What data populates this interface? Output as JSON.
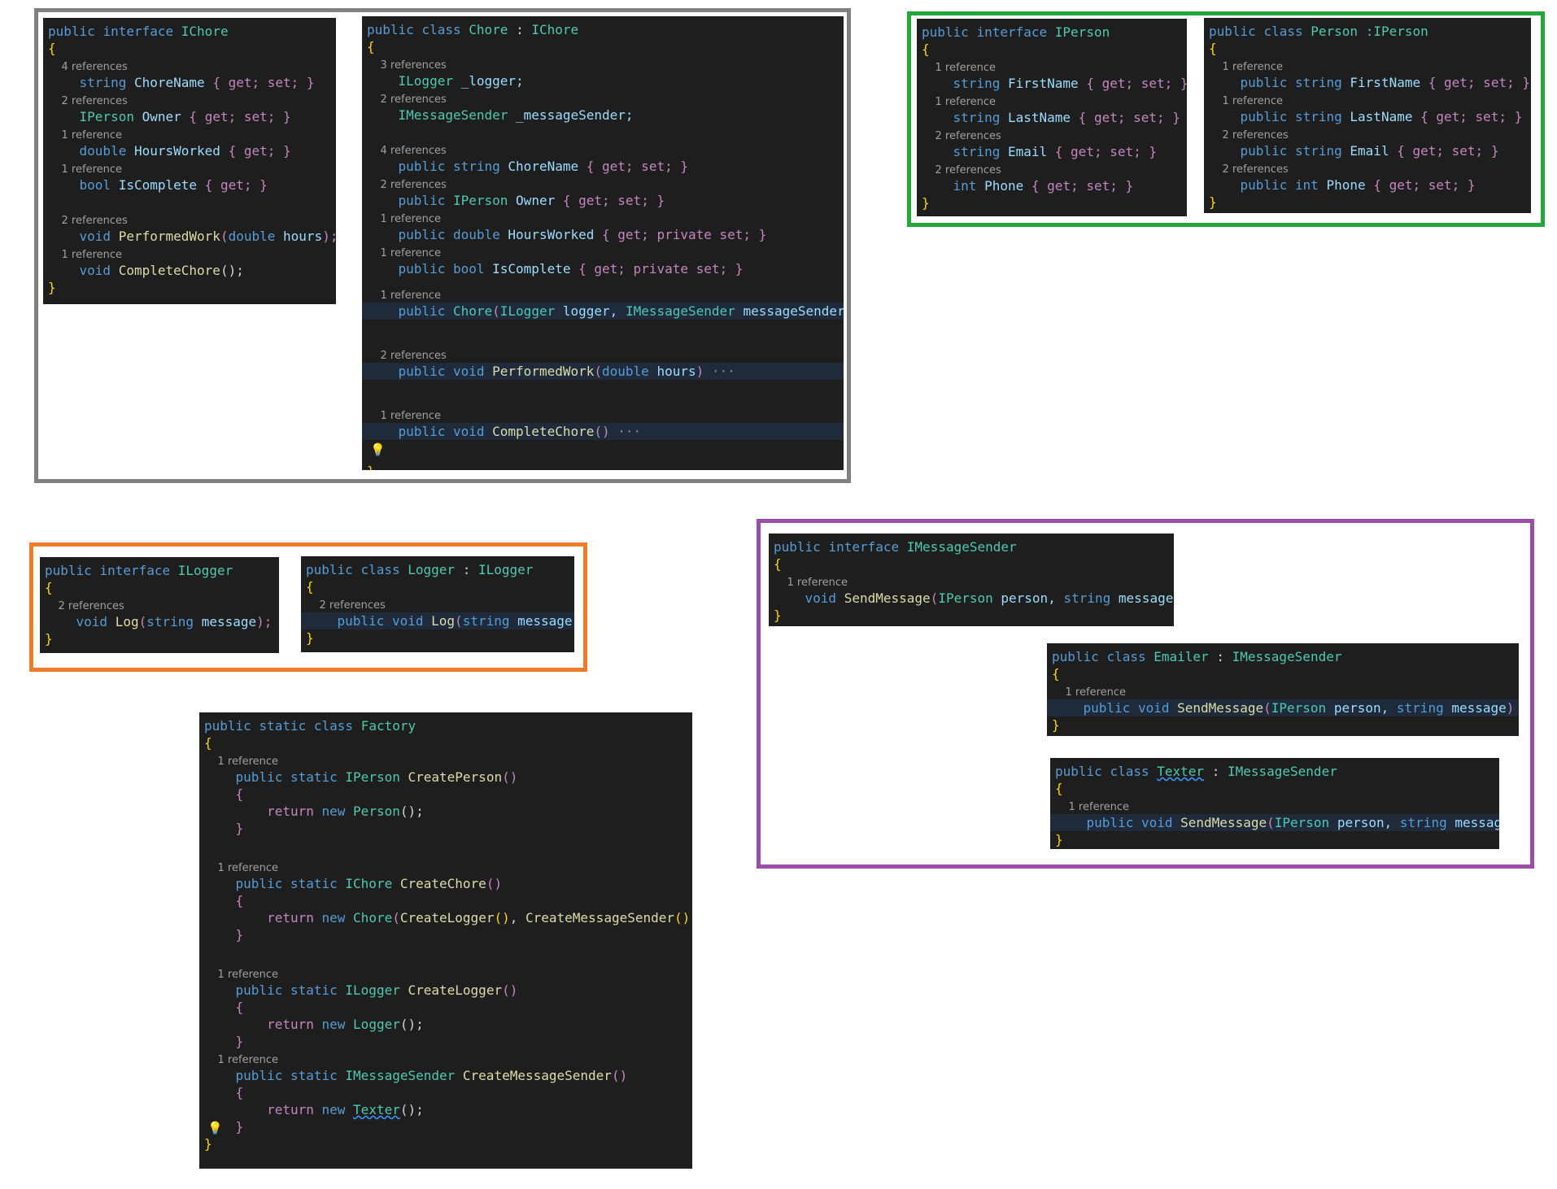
{
  "chore_interface": {
    "decl": [
      "public",
      "interface",
      "IChore"
    ],
    "open": "{",
    "close": "}",
    "members": [
      {
        "refs": "4 references",
        "type": "string",
        "name": "ChoreName",
        "acc": "{ get; set; }"
      },
      {
        "refs": "2 references",
        "type": "IPerson",
        "name": "Owner",
        "acc": "{ get; set; }"
      },
      {
        "refs": "1 reference",
        "type": "double",
        "name": "HoursWorked",
        "acc": "{ get; }"
      },
      {
        "refs": "1 reference",
        "type": "bool",
        "name": "IsComplete",
        "acc": "{ get; }"
      }
    ],
    "methods": [
      {
        "refs": "2 references",
        "ret": "void",
        "name": "PerformedWork",
        "ptype": "double",
        "pname": "hours",
        "tail": ");"
      },
      {
        "refs": "1 reference",
        "ret": "void",
        "name": "CompleteChore",
        "tail": "();"
      }
    ]
  },
  "chore_class": {
    "decl": [
      "public",
      "class",
      "Chore",
      ":",
      "IChore"
    ],
    "open": "{",
    "close": "}",
    "fields": [
      {
        "refs": "3 references",
        "type": "ILogger",
        "name": "_logger;"
      },
      {
        "refs": "2 references",
        "type": "IMessageSender",
        "name": "_messageSender;"
      }
    ],
    "props": [
      {
        "refs": "4 references",
        "mod": "public",
        "type": "string",
        "name": "ChoreName",
        "acc": "{ get; set; }"
      },
      {
        "refs": "2 references",
        "mod": "public",
        "type": "IPerson",
        "name": "Owner",
        "acc": "{ get; set; }"
      },
      {
        "refs": "1 reference",
        "mod": "public",
        "type": "double",
        "name": "HoursWorked",
        "acc": "{ get; private set; }"
      },
      {
        "refs": "1 reference",
        "mod": "public",
        "type": "bool",
        "name": "IsComplete",
        "acc": "{ get; private set; }"
      }
    ],
    "ctor": {
      "refs": "1 reference",
      "mod": "public",
      "name": "Chore",
      "p1type": "ILogger",
      "p1": "logger,",
      "p2type": "IMessageSender",
      "p2": "messageSender"
    },
    "methods": [
      {
        "refs": "2 references",
        "mod": "public",
        "ret": "void",
        "name": "PerformedWork",
        "ptype": "double",
        "pname": "hours",
        "ellipsis": "···"
      },
      {
        "refs": "1 reference",
        "mod": "public",
        "ret": "void",
        "name": "CompleteChore",
        "ellipsis": "···"
      }
    ]
  },
  "person_interface": {
    "decl": [
      "public",
      "interface",
      "IPerson"
    ],
    "open": "{",
    "close": "}",
    "members": [
      {
        "refs": "1 reference",
        "type": "string",
        "name": "FirstName",
        "acc": "{ get; set; }"
      },
      {
        "refs": "1 reference",
        "type": "string",
        "name": "LastName",
        "acc": "{ get; set; }"
      },
      {
        "refs": "2 references",
        "type": "string",
        "name": "Email",
        "acc": "{ get; set; }"
      },
      {
        "refs": "2 references",
        "type": "int",
        "name": "Phone",
        "acc": "{ get; set; }"
      }
    ]
  },
  "person_class": {
    "decl": [
      "public",
      "class",
      "Person",
      ":IPerson"
    ],
    "open": "{",
    "close": "}",
    "members": [
      {
        "refs": "1 reference",
        "mod": "public",
        "type": "string",
        "name": "FirstName",
        "acc": "{ get; set; }"
      },
      {
        "refs": "1 reference",
        "mod": "public",
        "type": "string",
        "name": "LastName",
        "acc": "{ get; set; }"
      },
      {
        "refs": "2 references",
        "mod": "public",
        "type": "string",
        "name": "Email",
        "acc": "{ get; set; }"
      },
      {
        "refs": "2 references",
        "mod": "public",
        "type": "int",
        "name": "Phone",
        "acc": "{ get; set; }"
      }
    ]
  },
  "logger_interface": {
    "decl": [
      "public",
      "interface",
      "ILogger"
    ],
    "open": "{",
    "close": "}",
    "method": {
      "refs": "2 references",
      "ret": "void",
      "name": "Log",
      "ptype": "string",
      "pname": "message",
      "tail": ");"
    }
  },
  "logger_class": {
    "decl": [
      "public",
      "class",
      "Logger",
      ":",
      "ILogger"
    ],
    "open": "{",
    "close": "}",
    "method": {
      "refs": "2 references",
      "mod": "public",
      "ret": "void",
      "name": "Log",
      "ptype": "string",
      "pname": "message",
      "tail": ")"
    }
  },
  "sender_interface": {
    "decl": [
      "public",
      "interface",
      "IMessageSender"
    ],
    "open": "{",
    "close": "}",
    "method": {
      "refs": "1 reference",
      "ret": "void",
      "name": "SendMessage",
      "p1type": "IPerson",
      "p1": "person,",
      "p2type": "string",
      "p2": "message",
      "tail": ");"
    }
  },
  "emailer_class": {
    "decl": [
      "public",
      "class",
      "Emailer",
      ":",
      "IMessageSender"
    ],
    "open": "{",
    "close": "}",
    "method": {
      "refs": "1 reference",
      "mod": "public",
      "ret": "void",
      "name": "SendMessage",
      "p1type": "IPerson",
      "p1": "person,",
      "p2type": "string",
      "p2": "message",
      "tail": ")",
      "ellipsis": "···"
    }
  },
  "texter_class": {
    "decl": [
      "public",
      "class",
      "Texter",
      ":",
      "IMessageSender"
    ],
    "open": "{",
    "close": "}",
    "method": {
      "refs": "1 reference",
      "mod": "public",
      "ret": "void",
      "name": "SendMessage",
      "p1type": "IPerson",
      "p1": "person,",
      "p2type": "string",
      "p2": "message",
      "tail": ")"
    }
  },
  "factory_class": {
    "decl": [
      "public",
      "static",
      "class",
      "Factory"
    ],
    "open": "{",
    "close": "}",
    "methods": [
      {
        "refs": "1 reference",
        "mods": "public static",
        "ret": "IPerson",
        "name": "CreatePerson",
        "open": "{",
        "close": "}",
        "ret_kw": "return",
        "new_kw": "new",
        "ctor": "Person",
        "args": "();"
      },
      {
        "refs": "1 reference",
        "mods": "public static",
        "ret": "IChore",
        "name": "CreateChore",
        "open": "{",
        "close": "}",
        "ret_kw": "return",
        "new_kw": "new",
        "ctor": "Chore",
        "arg1": "CreateLogger",
        "arg2": "CreateMessageSender"
      },
      {
        "refs": "1 reference",
        "mods": "public static",
        "ret": "ILogger",
        "name": "CreateLogger",
        "open": "{",
        "close": "}",
        "ret_kw": "return",
        "new_kw": "new",
        "ctor": "Logger",
        "args": "();"
      },
      {
        "refs": "1 reference",
        "mods": "public static",
        "ret": "IMessageSender",
        "name": "CreateMessageSender",
        "open": "{",
        "close": "}",
        "ret_kw": "return",
        "new_kw": "new",
        "ctor": "Texter",
        "args": "();"
      }
    ]
  },
  "colors": {
    "group_gray": "#808080",
    "group_green": "#21a83b",
    "group_orange": "#ef7b2a",
    "group_purple": "#9b4ea8",
    "editor_bg": "#1e1e1e",
    "keyword": "#569cd6",
    "type": "#4ec9b0",
    "identifier": "#9cdcfe",
    "function": "#dcdcaa"
  },
  "icons": [
    "lightbulb-icon"
  ]
}
